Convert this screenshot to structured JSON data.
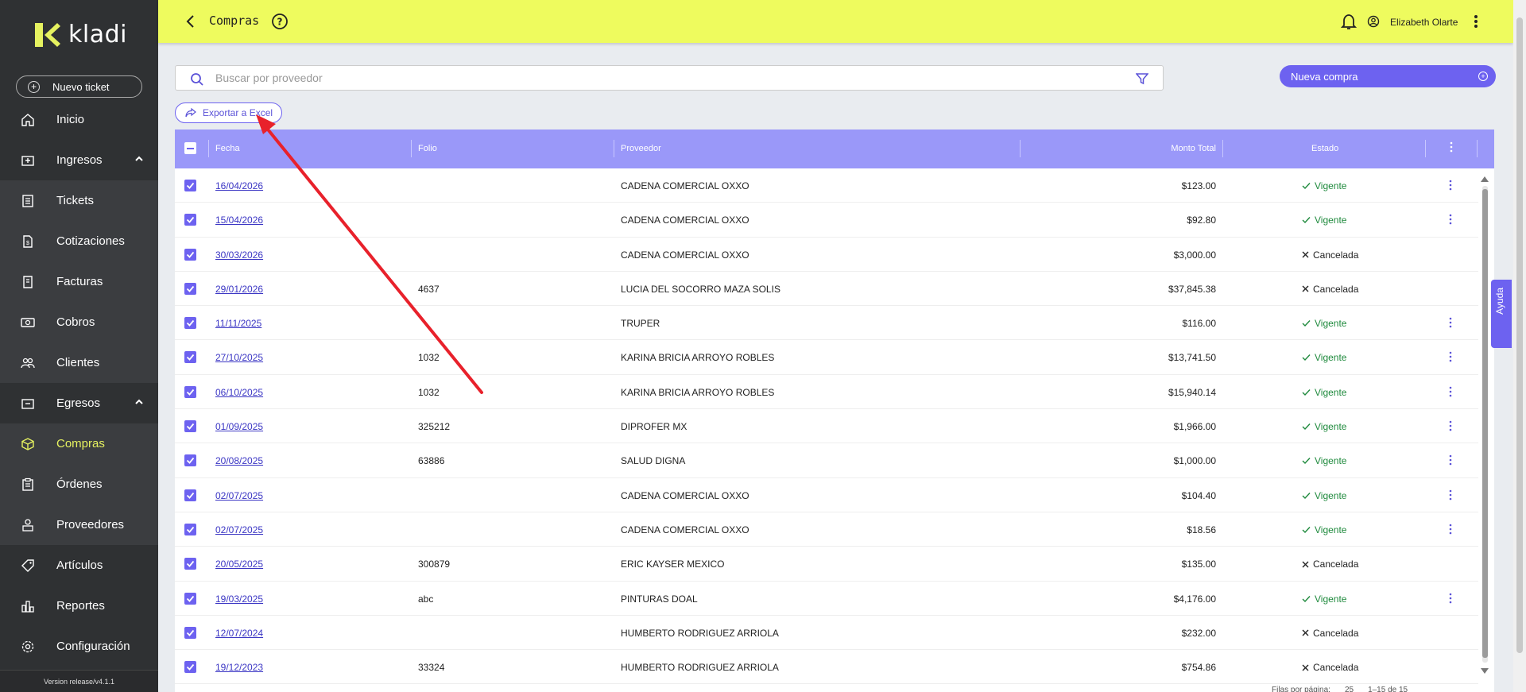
{
  "app": {
    "brand": "kladi",
    "version": "Version release/v4.1.1"
  },
  "sidebar": {
    "new_ticket": "Nuevo ticket",
    "items": [
      {
        "label": "Inicio",
        "icon": "home-icon"
      },
      {
        "label": "Ingresos",
        "icon": "income-icon"
      },
      {
        "label": "Tickets",
        "icon": "tickets-icon"
      },
      {
        "label": "Cotizaciones",
        "icon": "quote-icon"
      },
      {
        "label": "Facturas",
        "icon": "invoice-icon"
      },
      {
        "label": "Cobros",
        "icon": "cash-icon"
      },
      {
        "label": "Clientes",
        "icon": "clients-icon"
      },
      {
        "label": "Egresos",
        "icon": "expense-icon"
      },
      {
        "label": "Compras",
        "icon": "box-icon"
      },
      {
        "label": "Órdenes",
        "icon": "orders-icon"
      },
      {
        "label": "Proveedores",
        "icon": "supplier-icon"
      },
      {
        "label": "Artículos",
        "icon": "tag-icon"
      },
      {
        "label": "Reportes",
        "icon": "reports-icon"
      },
      {
        "label": "Configuración",
        "icon": "gear-icon"
      }
    ]
  },
  "header": {
    "title": "Compras",
    "user_name": "Elizabeth Olarte"
  },
  "search": {
    "placeholder": "Buscar por proveedor",
    "value": ""
  },
  "actions": {
    "new_purchase": "Nueva compra",
    "export": "Exportar a Excel"
  },
  "table": {
    "columns": {
      "fecha": "Fecha",
      "folio": "Folio",
      "proveedor": "Proveedor",
      "monto": "Monto Total",
      "estado": "Estado"
    },
    "rows": [
      {
        "fecha": "16/04/2026",
        "folio": "",
        "proveedor": "CADENA COMERCIAL OXXO",
        "monto": "$123.00",
        "estado": "Vigente",
        "ok": true
      },
      {
        "fecha": "15/04/2026",
        "folio": "",
        "proveedor": "CADENA COMERCIAL OXXO",
        "monto": "$92.80",
        "estado": "Vigente",
        "ok": true
      },
      {
        "fecha": "30/03/2026",
        "folio": "",
        "proveedor": "CADENA COMERCIAL OXXO",
        "monto": "$3,000.00",
        "estado": "Cancelada",
        "ok": false
      },
      {
        "fecha": "29/01/2026",
        "folio": "4637",
        "proveedor": "LUCIA DEL SOCORRO MAZA SOLIS",
        "monto": "$37,845.38",
        "estado": "Cancelada",
        "ok": false
      },
      {
        "fecha": "11/11/2025",
        "folio": "",
        "proveedor": "TRUPER",
        "monto": "$116.00",
        "estado": "Vigente",
        "ok": true
      },
      {
        "fecha": "27/10/2025",
        "folio": "1032",
        "proveedor": "KARINA BRICIA ARROYO ROBLES",
        "monto": "$13,741.50",
        "estado": "Vigente",
        "ok": true
      },
      {
        "fecha": "06/10/2025",
        "folio": "1032",
        "proveedor": "KARINA BRICIA ARROYO ROBLES",
        "monto": "$15,940.14",
        "estado": "Vigente",
        "ok": true
      },
      {
        "fecha": "01/09/2025",
        "folio": "325212",
        "proveedor": "DIPROFER MX",
        "monto": "$1,966.00",
        "estado": "Vigente",
        "ok": true
      },
      {
        "fecha": "20/08/2025",
        "folio": "63886",
        "proveedor": "SALUD DIGNA",
        "monto": "$1,000.00",
        "estado": "Vigente",
        "ok": true
      },
      {
        "fecha": "02/07/2025",
        "folio": "",
        "proveedor": "CADENA COMERCIAL OXXO",
        "monto": "$104.40",
        "estado": "Vigente",
        "ok": true
      },
      {
        "fecha": "02/07/2025",
        "folio": "",
        "proveedor": "CADENA COMERCIAL OXXO",
        "monto": "$18.56",
        "estado": "Vigente",
        "ok": true
      },
      {
        "fecha": "20/05/2025",
        "folio": "300879",
        "proveedor": "ERIC KAYSER MEXICO",
        "monto": "$135.00",
        "estado": "Cancelada",
        "ok": false
      },
      {
        "fecha": "19/03/2025",
        "folio": "abc",
        "proveedor": "PINTURAS DOAL",
        "monto": "$4,176.00",
        "estado": "Vigente",
        "ok": true
      },
      {
        "fecha": "12/07/2024",
        "folio": "",
        "proveedor": "HUMBERTO RODRIGUEZ ARRIOLA",
        "monto": "$232.00",
        "estado": "Cancelada",
        "ok": false
      },
      {
        "fecha": "19/12/2023",
        "folio": "33324",
        "proveedor": "HUMBERTO RODRIGUEZ ARRIOLA",
        "monto": "$754.86",
        "estado": "Cancelada",
        "ok": false
      }
    ],
    "footer": {
      "rows_per_page_label": "Filas por página:",
      "rows_per_page": "25",
      "range": "1–15 de 15"
    }
  },
  "help_tab": "Ayuda",
  "colors": {
    "accent": "#6d62f0",
    "header": "#eefb5e",
    "sidebar": "#2f3133",
    "vigente": "#1f8a3d"
  }
}
